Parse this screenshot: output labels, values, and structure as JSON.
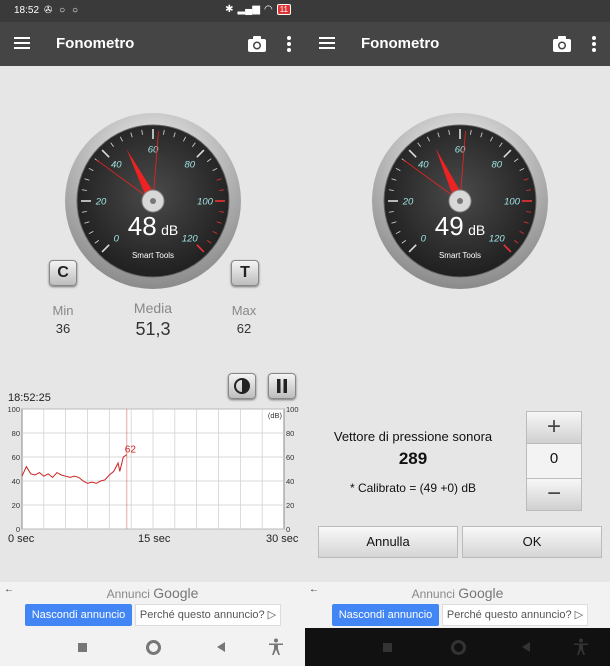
{
  "status": {
    "time": "18:52",
    "battery": "11"
  },
  "app": {
    "title": "Fonometro"
  },
  "gauge_scale": [
    "0",
    "20",
    "40",
    "60",
    "80",
    "100",
    "120"
  ],
  "left": {
    "gauge": {
      "value": "48",
      "unit": "dB",
      "brand": "Smart Tools"
    },
    "reset_button": "C",
    "tone_button": "T",
    "stats": {
      "min_label": "Min",
      "min_value": "36",
      "avg_label": "Media",
      "avg_value": "51,3",
      "max_label": "Max",
      "max_value": "62"
    },
    "chart_time": "18:52:25",
    "x_labels": [
      "0 sec",
      "15 sec",
      "30 sec"
    ]
  },
  "right": {
    "gauge": {
      "value": "49",
      "unit": "dB",
      "brand": "Smart Tools"
    },
    "calibration": {
      "title": "Vettore di pressione sonora",
      "value": "289",
      "formula": "* Calibrato = (49 +0) dB",
      "offset": "0",
      "plus": "+",
      "minus": "−"
    },
    "cancel": "Annulla",
    "ok": "OK"
  },
  "ad": {
    "back": "←",
    "title": "Annunci",
    "brand": "Google",
    "hide": "Nascondi annuncio",
    "why": "Perché questo annuncio? ▷"
  },
  "chart_data": {
    "type": "line",
    "title": "",
    "xlabel": "",
    "ylabel": "(dB)",
    "x_ticks": [
      "0 sec",
      "15 sec",
      "30 sec"
    ],
    "y_ticks": [
      0,
      20,
      40,
      60,
      80,
      100
    ],
    "xlim": [
      0,
      30
    ],
    "ylim": [
      0,
      100
    ],
    "grid": true,
    "peak_label": "62",
    "series": [
      {
        "x": [
          0,
          0.5,
          1,
          1.5,
          2,
          2.5,
          3,
          3.5,
          4,
          4.5,
          5,
          5.5,
          6,
          6.5,
          7,
          7.5,
          8,
          8.5,
          9,
          9.5,
          10,
          10.5,
          11,
          11.2,
          11.6,
          12
        ],
        "y": [
          44,
          52,
          46,
          45,
          47,
          44,
          46,
          43,
          47,
          45,
          44,
          43,
          44,
          43,
          40,
          38,
          39,
          38,
          40,
          41,
          45,
          48,
          55,
          48,
          60,
          62
        ]
      }
    ]
  }
}
